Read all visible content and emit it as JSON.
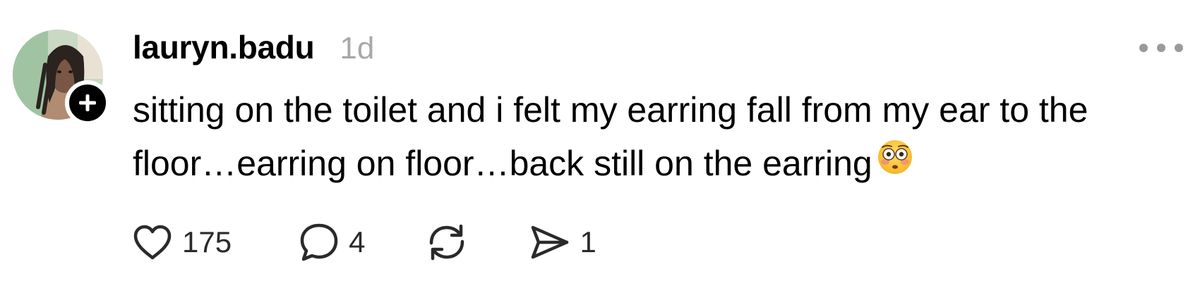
{
  "post": {
    "author": {
      "username": "lauryn.badu",
      "timestamp": "1d"
    },
    "text": "sitting on the toilet and i felt my earring fall from my ear to the floor…earring on floor…back still on the earring",
    "emoji": "flushed-face",
    "stats": {
      "likes": "175",
      "replies": "4",
      "shares": "1"
    }
  },
  "icons": {
    "avatar": "profile-photo",
    "follow": "plus-icon",
    "more": "ellipsis-icon",
    "like": "heart-icon",
    "reply": "speech-bubble-icon",
    "repost": "repost-icon",
    "share": "paper-plane-icon"
  }
}
